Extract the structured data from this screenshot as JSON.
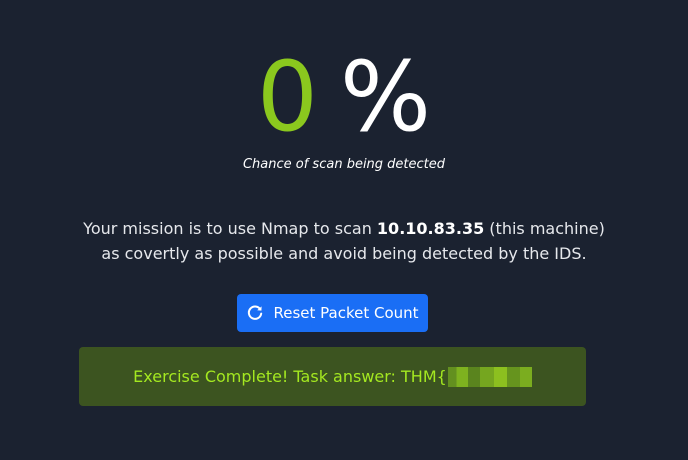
{
  "detection": {
    "value": "0",
    "unit": "%",
    "caption": "Chance of scan being detected"
  },
  "mission": {
    "line1_pre": "Your mission is to use Nmap to scan ",
    "ip": "10.10.83.35",
    "line1_post": " (this machine)",
    "line2": "as covertly as possible and avoid being detected by the IDS."
  },
  "reset_button": {
    "label": "Reset Packet Count",
    "icon": "refresh-icon"
  },
  "result": {
    "text": "Exercise Complete! Task answer: THM{",
    "redacted": true
  },
  "colors": {
    "background": "#1b2230",
    "score_green": "#8bc81e",
    "button_blue": "#1a6ef5",
    "alert_bg": "#3c5420",
    "alert_text": "#a4e820"
  }
}
